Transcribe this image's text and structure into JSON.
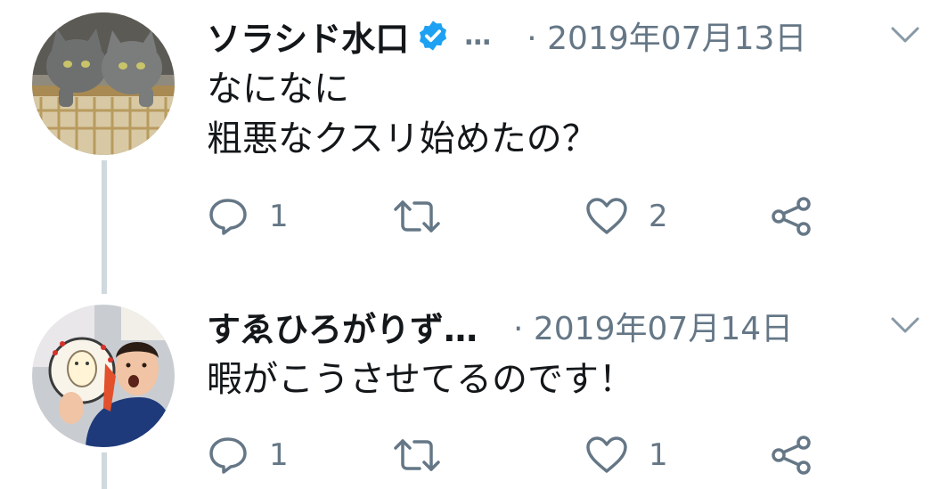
{
  "tweets": [
    {
      "author_name": "ソラシド水口",
      "verified": true,
      "name_overflow": "…",
      "date": "· 2019年07月13日",
      "text": "なになに\n粗悪なクスリ始めたの？",
      "reply_count": "1",
      "retweet_count": "",
      "like_count": "2"
    },
    {
      "author_name": "すゑひろがりず…",
      "verified": false,
      "name_overflow": "",
      "date": "· 2019年07月14日",
      "text": "暇がこうさせてるのです！",
      "reply_count": "1",
      "retweet_count": "",
      "like_count": "1"
    }
  ],
  "icons": {
    "reply": "speech-bubble-icon",
    "retweet": "retweet-arrows-icon",
    "like": "heart-icon",
    "share": "share-nodes-icon",
    "menu": "chevron-down-icon",
    "verified": "verified-badge-icon"
  },
  "colors": {
    "text": "#14171a",
    "secondary": "#657786",
    "verified": "#1da1f2",
    "thread_line": "#cfd9de"
  }
}
